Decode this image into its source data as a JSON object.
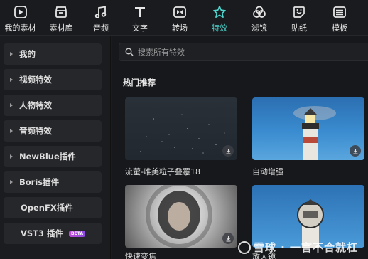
{
  "toolbar": {
    "tabs": [
      {
        "label": "我的素材",
        "icon": "my-media-icon"
      },
      {
        "label": "素材库",
        "icon": "library-icon"
      },
      {
        "label": "音频",
        "icon": "music-note-icon"
      },
      {
        "label": "文字",
        "icon": "text-icon"
      },
      {
        "label": "转场",
        "icon": "transition-icon"
      },
      {
        "label": "特效",
        "icon": "effects-star-icon",
        "active": true
      },
      {
        "label": "滤镜",
        "icon": "filter-icon"
      },
      {
        "label": "贴纸",
        "icon": "sticker-icon"
      },
      {
        "label": "模板",
        "icon": "template-icon"
      }
    ],
    "active_color": "#4fd6cf"
  },
  "sidebar": {
    "items": [
      {
        "label": "我的",
        "arrow": true
      },
      {
        "label": "视频特效",
        "arrow": true
      },
      {
        "label": "人物特效",
        "arrow": true
      },
      {
        "label": "音频特效",
        "arrow": true
      },
      {
        "label": "NewBlue插件",
        "arrow": true
      },
      {
        "label": "Boris插件",
        "arrow": true
      },
      {
        "label": "OpenFX插件",
        "arrow": false
      },
      {
        "label": "VST3 插件",
        "arrow": false,
        "badge": "BETA"
      }
    ]
  },
  "search": {
    "placeholder": "搜索所有特效"
  },
  "section": {
    "title": "热门推荐"
  },
  "cards": [
    {
      "name": "流萤-唯美粒子叠覆18"
    },
    {
      "name": "自动增强"
    },
    {
      "name": "快速变焦"
    },
    {
      "name": "放大镜"
    }
  ],
  "watermark": {
    "text": "雪球 · 一言不合就杠"
  }
}
